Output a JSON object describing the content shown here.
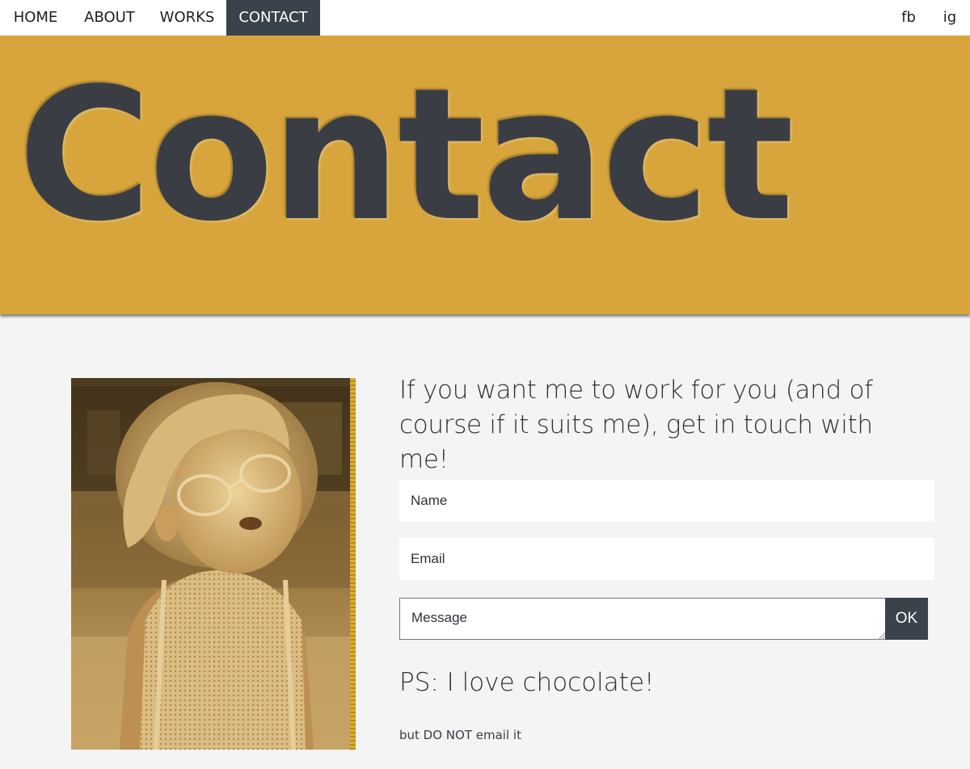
{
  "nav": {
    "items": [
      {
        "label": "HOME"
      },
      {
        "label": "ABOUT"
      },
      {
        "label": "WORKS"
      },
      {
        "label": "CONTACT",
        "active": true
      }
    ],
    "social": [
      {
        "label": "fb"
      },
      {
        "label": "ig"
      }
    ]
  },
  "hero": {
    "title": "Contact",
    "background_color": "#d7a53b",
    "text_color": "#3a3e44"
  },
  "main": {
    "intro": "If you want me to work for you (and of course if it suits me), get in touch with me!",
    "form": {
      "name_placeholder": "Name",
      "email_placeholder": "Email",
      "message_placeholder": "Message",
      "submit_label": "OK"
    },
    "ps": "PS: I love chocolate!",
    "ps_sub": "but DO NOT email it"
  },
  "colors": {
    "accent": "#d7a53b",
    "dark": "#3a424c",
    "page_bg": "#f4f4f4"
  }
}
